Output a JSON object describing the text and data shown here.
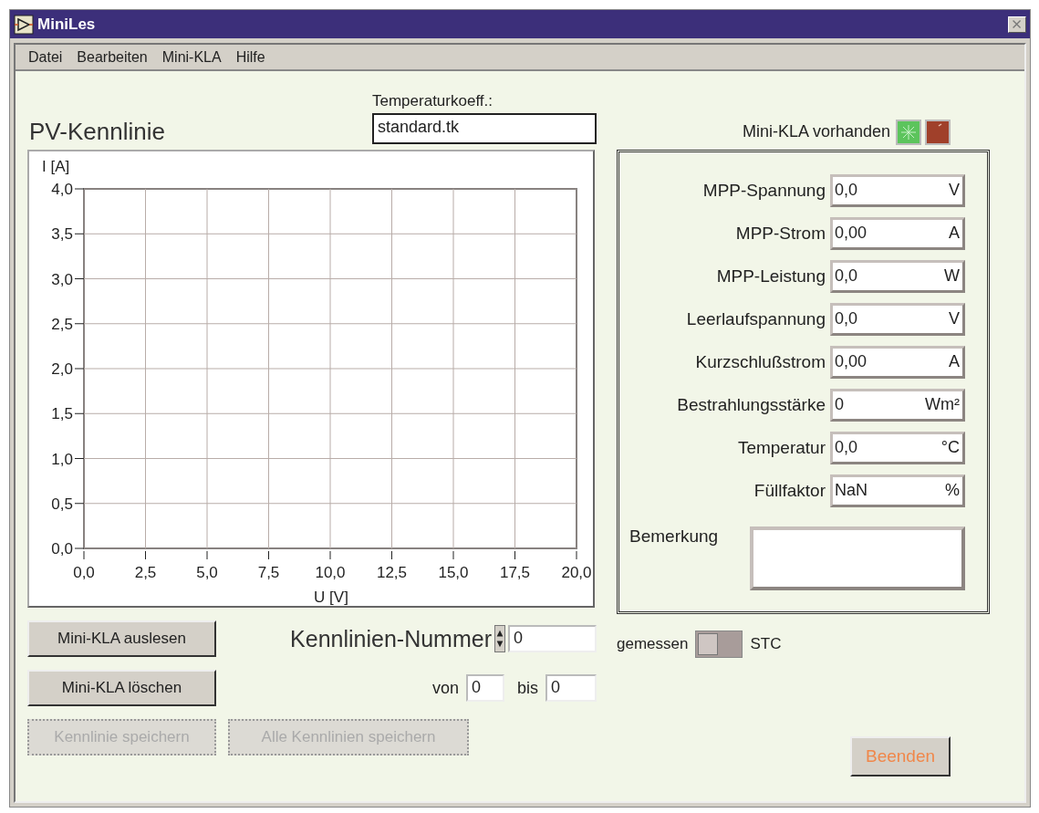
{
  "window": {
    "title": "MiniLes"
  },
  "menu": [
    "Datei",
    "Bearbeiten",
    "Mini-KLA",
    "Hilfe"
  ],
  "chart_title": "PV-Kennlinie",
  "temp_coeff": {
    "label": "Temperaturkoeff.:",
    "value": "standard.tk"
  },
  "chart": {
    "chart_data": {
      "type": "line",
      "grid": true,
      "xlabel": "U [V]",
      "ylabel": "I [A]",
      "xlim": [
        0,
        20
      ],
      "ylim": [
        0,
        4
      ],
      "xticks": [
        {
          "value": 0,
          "label": "0,0"
        },
        {
          "value": 2.5,
          "label": "2,5"
        },
        {
          "value": 5,
          "label": "5,0"
        },
        {
          "value": 7.5,
          "label": "7,5"
        },
        {
          "value": 10,
          "label": "10,0"
        },
        {
          "value": 12.5,
          "label": "12,5"
        },
        {
          "value": 15,
          "label": "15,0"
        },
        {
          "value": 17.5,
          "label": "17,5"
        },
        {
          "value": 20,
          "label": "20,0"
        }
      ],
      "yticks": [
        {
          "value": 0,
          "label": "0,0"
        },
        {
          "value": 0.5,
          "label": "0,5"
        },
        {
          "value": 1,
          "label": "1,0"
        },
        {
          "value": 1.5,
          "label": "1,5"
        },
        {
          "value": 2,
          "label": "2,0"
        },
        {
          "value": 2.5,
          "label": "2,5"
        },
        {
          "value": 3,
          "label": "3,0"
        },
        {
          "value": 3.5,
          "label": "3,5"
        },
        {
          "value": 4,
          "label": "4,0"
        }
      ]
    }
  },
  "device_status": {
    "label": "Mini-KLA vorhanden",
    "on": true
  },
  "measurements": [
    {
      "label": "MPP-Spannung",
      "value": "0,0",
      "unit": "V"
    },
    {
      "label": "MPP-Strom",
      "value": "0,00",
      "unit": "A"
    },
    {
      "label": "MPP-Leistung",
      "value": "0,0",
      "unit": "W"
    },
    {
      "label": "Leerlaufspannung",
      "value": "0,0",
      "unit": "V"
    },
    {
      "label": "Kurzschlußstrom",
      "value": "0,00",
      "unit": "A"
    },
    {
      "label": "Bestrahlungsstärke",
      "value": "0",
      "unit": "Wm²"
    },
    {
      "label": "Temperatur",
      "value": "0,0",
      "unit": "°C"
    },
    {
      "label": "Füllfaktor",
      "value": "NaN",
      "unit": "%"
    }
  ],
  "remark": {
    "label": "Bemerkung"
  },
  "buttons": [
    {
      "label": "Mini-KLA auslesen",
      "disabled": false
    },
    {
      "label": "Mini-KLA löschen",
      "disabled": false
    },
    {
      "label": "Kennlinie speichern",
      "disabled": true
    },
    {
      "label": "Alle Kennlinien speichern",
      "disabled": true
    }
  ],
  "curve_number": {
    "label": "Kennlinien-Nummer",
    "value": "0"
  },
  "range": {
    "from_label": "von",
    "from_value": "0",
    "to_label": "bis",
    "to_value": "0"
  },
  "mode_switch": {
    "left_label": "gemessen",
    "right_label": "STC",
    "on": false
  },
  "quit_button": {
    "label": "Beenden"
  }
}
